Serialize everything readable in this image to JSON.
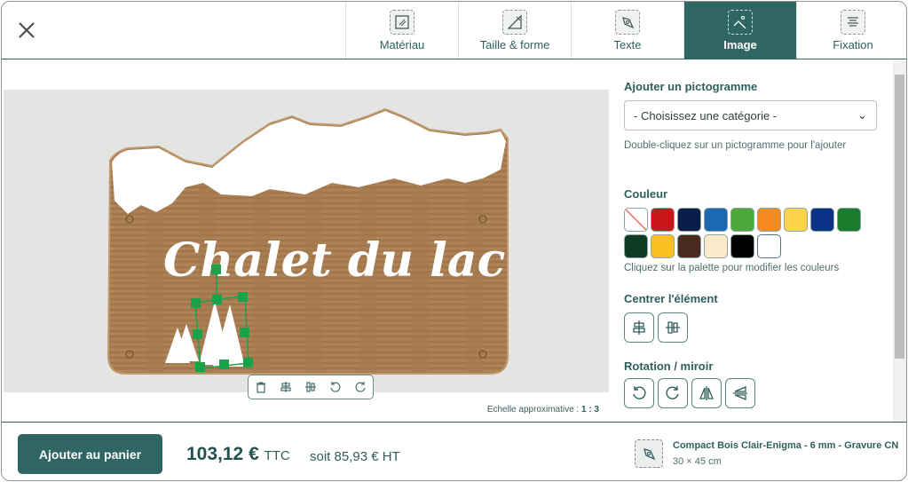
{
  "header": {
    "tabs": [
      {
        "label": "Matériau",
        "icon": "material-icon"
      },
      {
        "label": "Taille & forme",
        "icon": "size-shape-icon"
      },
      {
        "label": "Texte",
        "icon": "pen-icon"
      },
      {
        "label": "Image",
        "icon": "image-icon",
        "active": true
      },
      {
        "label": "Fixation",
        "icon": "screw-icon"
      }
    ]
  },
  "preview": {
    "sign_text": "Chalet du lac",
    "scale_label": "Echelle approximative : ",
    "scale_value": "1 : 3"
  },
  "panel": {
    "pictogram_title": "Ajouter un pictogramme",
    "category_select": "- Choisissez une catégorie -",
    "pictogram_hint": "Double-cliquez sur un pictogramme pour l'ajouter",
    "color_title": "Couleur",
    "colors": [
      "none",
      "#c8171a",
      "#0b1e4a",
      "#1b69b3",
      "#4fa83a",
      "#f58a1f",
      "#fdd54c",
      "#0a3388",
      "#1a7d2e",
      "#0e3b21",
      "#fbbf24",
      "#4a2a1e",
      "#fcebcb",
      "#000000",
      "#ffffff"
    ],
    "color_hint": "Cliquez sur la palette pour modifier les couleurs",
    "center_title": "Centrer l'élément",
    "rotation_title": "Rotation / miroir"
  },
  "footer": {
    "add_to_cart": "Ajouter au panier",
    "price_ttc": "103,12 €",
    "ttc_label": "TTC",
    "price_ht": "soit 85,93 € HT",
    "product_name": "Compact Bois Clair-Enigma - 6 mm - Gravure CN",
    "product_size": "30 × 45 cm"
  },
  "accent": "#2f6563"
}
